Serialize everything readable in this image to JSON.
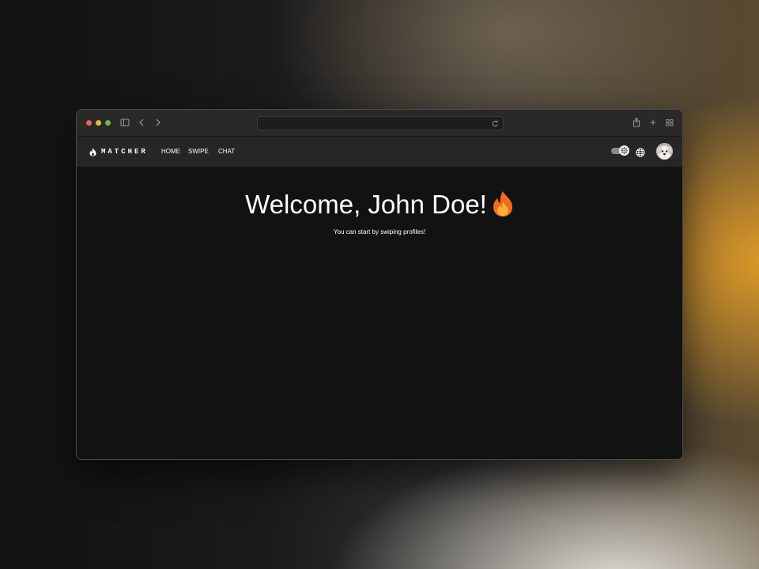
{
  "browser": {
    "url": ""
  },
  "navbar": {
    "logo_text": "MATCHER",
    "links": [
      {
        "label": "HOME"
      },
      {
        "label": "SWIPE"
      },
      {
        "label": "CHAT"
      }
    ],
    "theme_toggle": {
      "state": "on"
    },
    "language_icon": "globe-icon",
    "avatar_icon": "user-avatar"
  },
  "main": {
    "greeting": "Welcome, John Doe!",
    "greeting_emoji": "fire-emoji",
    "subtitle": "You can start by swiping profiles!"
  },
  "colors": {
    "accent": "#f58a1f",
    "background": "#121212",
    "navbar": "#262626"
  }
}
